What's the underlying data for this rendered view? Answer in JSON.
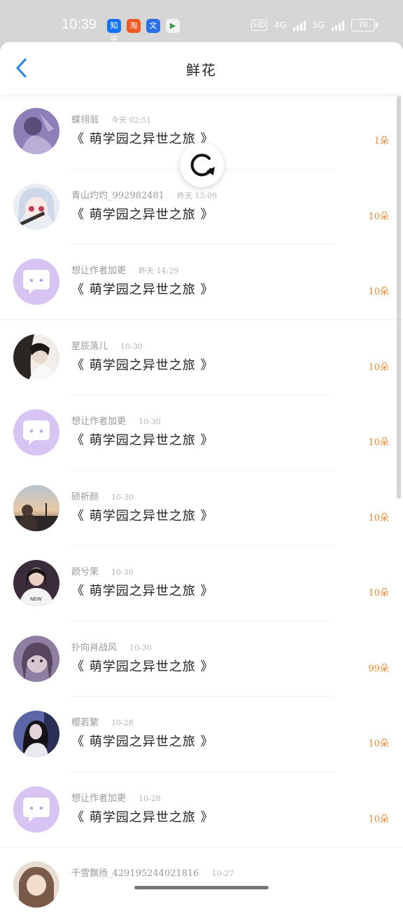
{
  "status_bar": {
    "time": "10:39",
    "apps": [
      {
        "icon": "zhihu-app-icon",
        "label": "知乎",
        "color": "#1772f6"
      },
      {
        "icon": "taobao-app-icon",
        "label": "淘",
        "color": "#f05a22"
      },
      {
        "icon": "translate-app-icon",
        "label": "文",
        "color": "#2970e8"
      },
      {
        "icon": "play-app-icon",
        "label": "▶",
        "color": "#f2f2f2"
      }
    ],
    "hd": "HD",
    "net1": "4G",
    "net2": "5G",
    "battery": "76"
  },
  "header": {
    "title": "鲜花",
    "accent": "#2f8ee5"
  },
  "colors": {
    "count": "#e88a3a",
    "default_avatar_bg": "#d8c4f2"
  },
  "items": [
    {
      "name": "蝶翎翁",
      "time": "今天 02:51",
      "book": "《 萌学园之异世之旅 》",
      "count": "1朵",
      "avatar": "photo-purple"
    },
    {
      "name": "青山灼灼_992982481",
      "time": "昨天 15:09",
      "book": "《 萌学园之异世之旅 》",
      "count": "10朵",
      "avatar": "anime-girl"
    },
    {
      "name": "想让作者加更",
      "time": "昨天 14:29",
      "book": "《 萌学园之异世之旅 》",
      "count": "10朵",
      "avatar": "default"
    },
    {
      "name": "星辰落儿",
      "time": "10-30",
      "book": "《 萌学园之异世之旅 》",
      "count": "10朵",
      "avatar": "photo-dark"
    },
    {
      "name": "想让作者加更",
      "time": "10-30",
      "book": "《 萌学园之异世之旅 》",
      "count": "10朵",
      "avatar": "default"
    },
    {
      "name": "硕祈颜",
      "time": "10-30",
      "book": "《 萌学园之异世之旅 》",
      "count": "10朵",
      "avatar": "photo-sunset"
    },
    {
      "name": "颜兮茉",
      "time": "10-30",
      "book": "《 萌学园之异世之旅 》",
      "count": "10朵",
      "avatar": "photo-girl"
    },
    {
      "name": "扑向肖战风",
      "time": "10-30",
      "book": "《 萌学园之异世之旅 》",
      "count": "99朵",
      "avatar": "photo-soft"
    },
    {
      "name": "樱若繁",
      "time": "10-28",
      "book": "《 萌学园之异世之旅 》",
      "count": "10朵",
      "avatar": "photo-night"
    },
    {
      "name": "想让作者加更",
      "time": "10-28",
      "book": "《 萌学园之异世之旅 》",
      "count": "10朵",
      "avatar": "default"
    },
    {
      "name": "千雪飘扬_429195244021816",
      "time": "10-27",
      "book": "",
      "count": "",
      "avatar": "photo-brown"
    }
  ]
}
